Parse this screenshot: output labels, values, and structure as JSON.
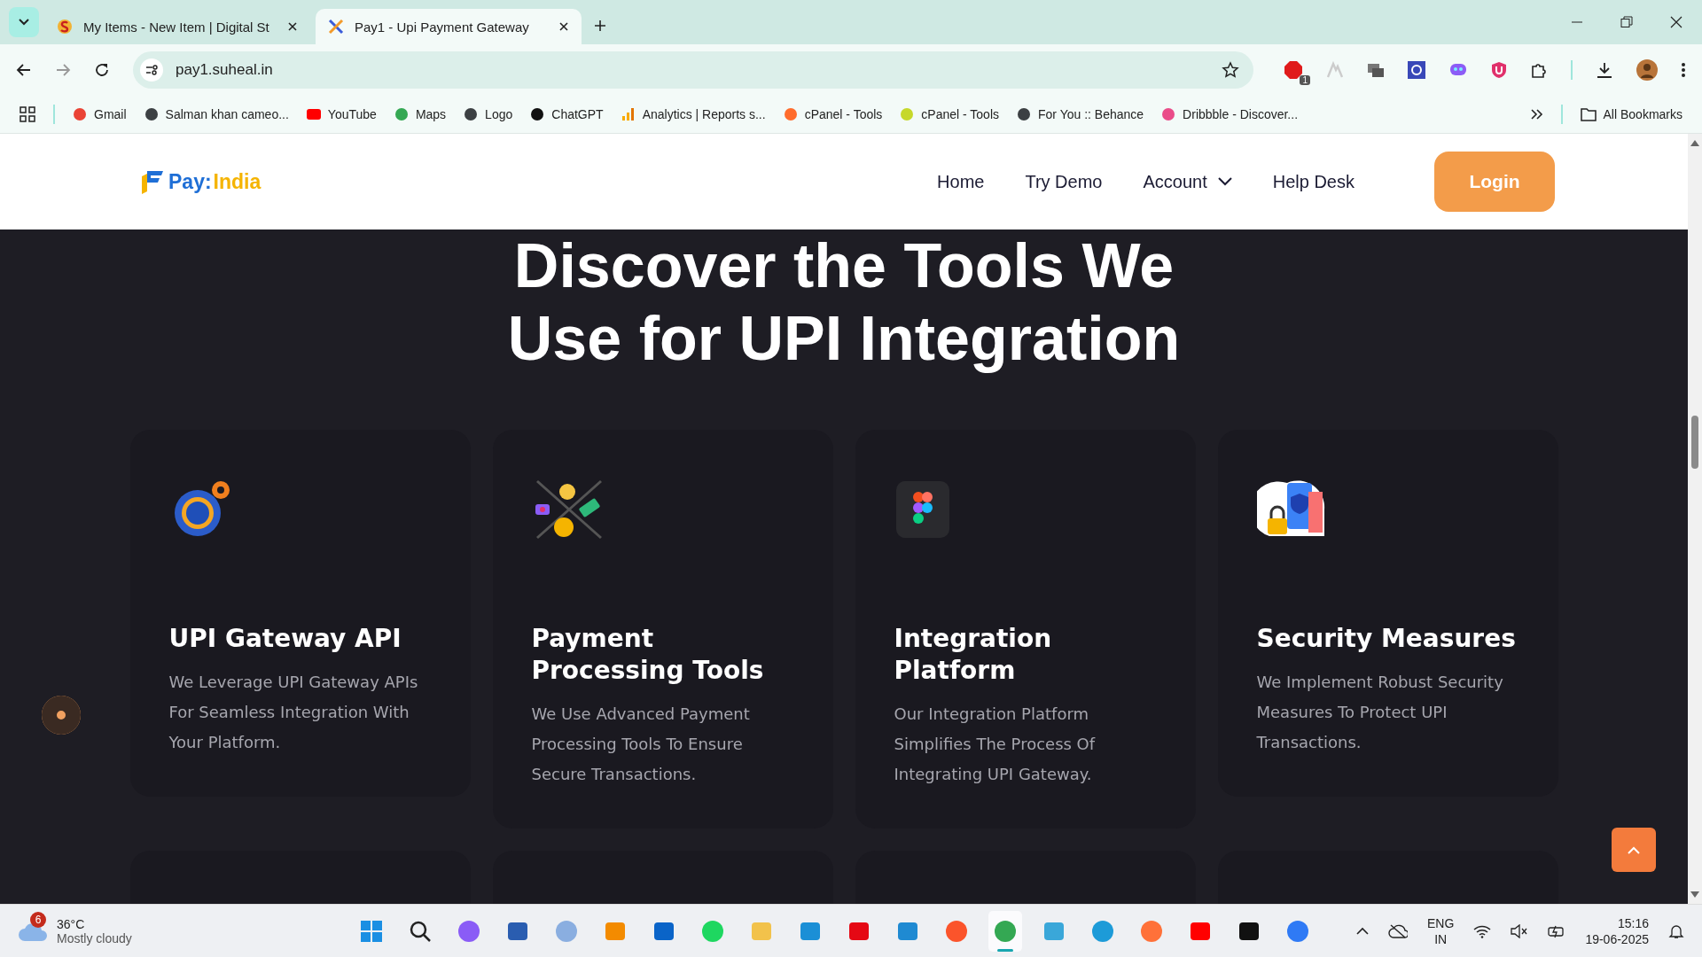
{
  "browser": {
    "tabs": [
      {
        "title": "My Items - New Item | Digital St",
        "selected": false,
        "kind": "store"
      },
      {
        "title": "Pay1 - Upi Payment Gateway",
        "selected": true,
        "kind": "pay"
      }
    ],
    "address": "pay1.suheal.in",
    "extension_badge": "1",
    "bookmarks": [
      {
        "label": "Gmail",
        "kind": "gmail"
      },
      {
        "label": "Salman khan cameo...",
        "kind": "globe"
      },
      {
        "label": "YouTube",
        "kind": "youtube"
      },
      {
        "label": "Maps",
        "kind": "maps"
      },
      {
        "label": "Logo",
        "kind": "globe"
      },
      {
        "label": "ChatGPT",
        "kind": "chatgpt"
      },
      {
        "label": "Analytics | Reports s...",
        "kind": "analytics"
      },
      {
        "label": "cPanel - Tools",
        "kind": "cpanel"
      },
      {
        "label": "cPanel - Tools",
        "kind": "tohost"
      },
      {
        "label": "For You :: Behance",
        "kind": "globe"
      },
      {
        "label": "Dribbble - Discover...",
        "kind": "dribbble"
      }
    ],
    "all_bookmarks": "All Bookmarks"
  },
  "site": {
    "logo": {
      "prefix": "Pay:",
      "suffix": "India"
    },
    "nav": [
      {
        "label": "Home",
        "dropdown": false
      },
      {
        "label": "Try Demo",
        "dropdown": false
      },
      {
        "label": "Account",
        "dropdown": true
      },
      {
        "label": "Help Desk",
        "dropdown": false
      }
    ],
    "login": "Login",
    "heading": [
      "Discover the Tools We",
      "Use for UPI Integration"
    ],
    "cards": [
      {
        "kind": "api",
        "title": "UPI Gateway API",
        "description": "We Leverage UPI Gateway APIs For Seamless Integration With Your Platform."
      },
      {
        "kind": "tools",
        "title": "Payment Processing Tools",
        "description": "We Use Advanced Payment Processing Tools To Ensure Secure Transactions."
      },
      {
        "kind": "figma",
        "title": "Integration Platform",
        "description": "Our Integration Platform Simplifies The Process Of Integrating UPI Gateway."
      },
      {
        "kind": "security",
        "title": "Security Measures",
        "description": "We Implement Robust Security Measures To Protect UPI Transactions."
      }
    ]
  },
  "taskbar": {
    "weather": {
      "badge": "6",
      "temperature": "36°C",
      "condition": "Mostly cloudy"
    },
    "apps": [
      {
        "kind": "windows",
        "active": false
      },
      {
        "kind": "search",
        "active": false
      },
      {
        "kind": "copilot",
        "active": false
      },
      {
        "kind": "remote",
        "active": false
      },
      {
        "kind": "r",
        "active": false
      },
      {
        "kind": "vmware",
        "active": false
      },
      {
        "kind": "outlook",
        "active": false
      },
      {
        "kind": "spotify",
        "active": false
      },
      {
        "kind": "folder",
        "active": false
      },
      {
        "kind": "prime",
        "active": false
      },
      {
        "kind": "netflix",
        "active": false
      },
      {
        "kind": "vscode",
        "active": false
      },
      {
        "kind": "brave",
        "active": false
      },
      {
        "kind": "chrome",
        "active": true
      },
      {
        "kind": "notepad",
        "active": false
      },
      {
        "kind": "edge",
        "active": false
      },
      {
        "kind": "firefox",
        "active": false
      },
      {
        "kind": "youtube",
        "active": false
      },
      {
        "kind": "cube",
        "active": false
      },
      {
        "kind": "store",
        "active": false
      }
    ],
    "language": "ENG",
    "region": "IN",
    "time": "15:16",
    "date": "19-06-2025"
  }
}
